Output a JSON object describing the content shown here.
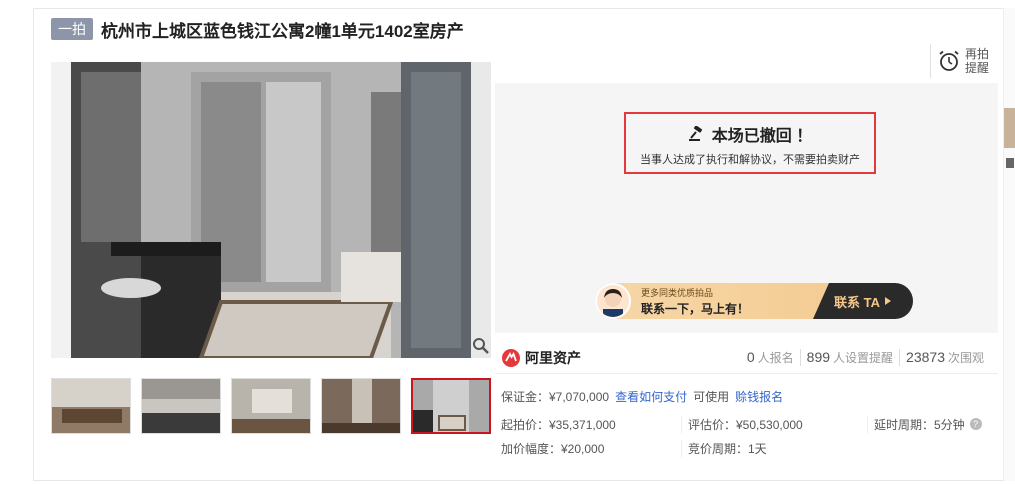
{
  "header": {
    "tag": "一拍",
    "title": "杭州市上城区蓝色钱江公寓2幢1单元1402室房产"
  },
  "remind": {
    "line1": "再拍",
    "line2": "提醒"
  },
  "notice": {
    "title": "本场已撤回 ！",
    "subtitle": "当事人达成了执行和解协议，不需要拍卖财产"
  },
  "banner": {
    "small": "更多同类优质拍品",
    "big": "联系一下，马上有！",
    "cta": "联系 TA"
  },
  "brand": {
    "logo_text": "阿里资产"
  },
  "stats": [
    {
      "num": "0",
      "label": "人报名"
    },
    {
      "num": "899",
      "label": "人设置提醒"
    },
    {
      "num": "23873",
      "label": "次围观"
    }
  ],
  "deposit": {
    "label": "保证金：¥7,070,000",
    "link1": "查看如何支付",
    "mid": "可使用",
    "link2": "赊钱报名"
  },
  "prices": {
    "start": "起拍价：¥35,371,000",
    "assess": "评估价：¥50,530,000",
    "delay": "延时周期：5分钟",
    "increment": "加价幅度：¥20,000",
    "cycle": "竞价周期：1天"
  },
  "colors": {
    "accent": "#e4393c",
    "link": "#3366cc",
    "tag_bg": "#8c96a8"
  }
}
